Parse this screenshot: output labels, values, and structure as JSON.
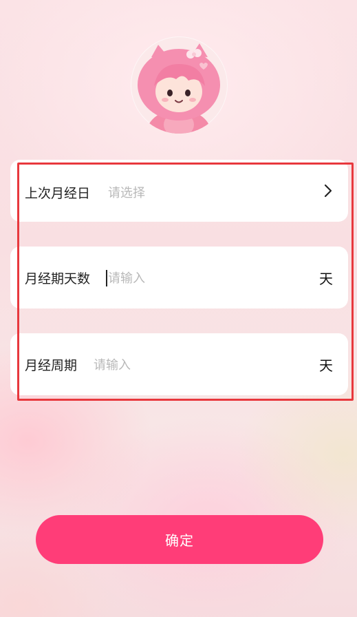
{
  "avatar": {
    "icon": "cartoon-girl-avatar"
  },
  "form": {
    "last_period": {
      "label": "上次月经日",
      "placeholder": "请选择",
      "icon": "chevron-right-icon"
    },
    "period_days": {
      "label": "月经期天数",
      "placeholder": "请输入",
      "unit": "天"
    },
    "cycle": {
      "label": "月经周期",
      "placeholder": "请输入",
      "unit": "天"
    }
  },
  "confirm": {
    "label": "确定"
  },
  "colors": {
    "accent": "#ff3d78",
    "highlight": "#e8383d",
    "placeholder": "#b8b8b8"
  }
}
